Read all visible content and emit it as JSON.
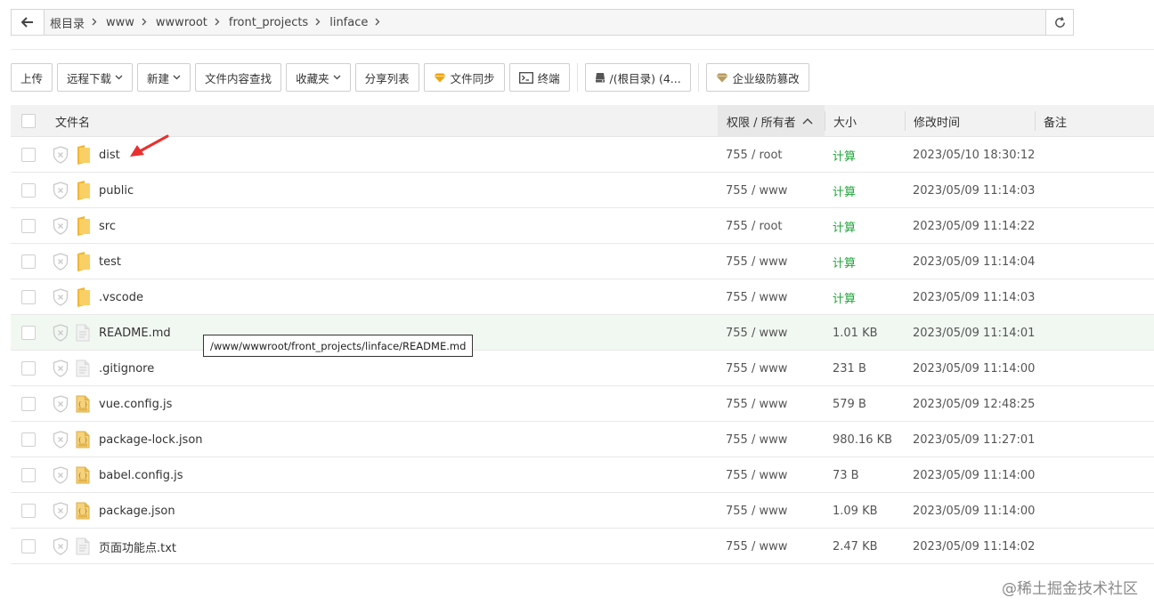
{
  "breadcrumb": [
    "根目录",
    "www",
    "wwwroot",
    "front_projects",
    "linface"
  ],
  "toolbar": {
    "upload": "上传",
    "remote_download": "远程下载",
    "new": "新建",
    "content_search": "文件内容查找",
    "favorites": "收藏夹",
    "share_list": "分享列表",
    "file_sync": "文件同步",
    "terminal": "终端",
    "disk": "/(根目录) (4...",
    "tamper": "企业级防篡改"
  },
  "columns": {
    "name": "文件名",
    "perm": "权限 / 所有者",
    "size": "大小",
    "mtime": "修改时间",
    "note": "备注"
  },
  "files": [
    {
      "name": "dist",
      "type": "folder",
      "perm": "755 / root",
      "size": "计算",
      "mtime": "2023/05/10 18:30:12"
    },
    {
      "name": "public",
      "type": "folder",
      "perm": "755 / www",
      "size": "计算",
      "mtime": "2023/05/09 11:14:03"
    },
    {
      "name": "src",
      "type": "folder",
      "perm": "755 / root",
      "size": "计算",
      "mtime": "2023/05/09 11:14:22"
    },
    {
      "name": "test",
      "type": "folder",
      "perm": "755 / www",
      "size": "计算",
      "mtime": "2023/05/09 11:14:04"
    },
    {
      "name": ".vscode",
      "type": "folder",
      "perm": "755 / www",
      "size": "计算",
      "mtime": "2023/05/09 11:14:03"
    },
    {
      "name": "README.md",
      "type": "text",
      "perm": "755 / www",
      "size": "1.01 KB",
      "mtime": "2023/05/09 11:14:01"
    },
    {
      "name": ".gitignore",
      "type": "text",
      "perm": "755 / www",
      "size": "231 B",
      "mtime": "2023/05/09 11:14:00"
    },
    {
      "name": "vue.config.js",
      "type": "code",
      "perm": "755 / www",
      "size": "579 B",
      "mtime": "2023/05/09 12:48:25"
    },
    {
      "name": "package-lock.json",
      "type": "code",
      "perm": "755 / www",
      "size": "980.16 KB",
      "mtime": "2023/05/09 11:27:01"
    },
    {
      "name": "babel.config.js",
      "type": "code",
      "perm": "755 / www",
      "size": "73 B",
      "mtime": "2023/05/09 11:14:00"
    },
    {
      "name": "package.json",
      "type": "code",
      "perm": "755 / www",
      "size": "1.09 KB",
      "mtime": "2023/05/09 11:14:00"
    },
    {
      "name": "页面功能点.txt",
      "type": "text",
      "perm": "755 / www",
      "size": "2.47 KB",
      "mtime": "2023/05/09 11:14:02"
    }
  ],
  "hover_row": 5,
  "tooltip": "/www/wwwroot/front_projects/linface/README.md",
  "watermark": "@稀土掘金技术社区",
  "colors": {
    "accent_green": "#20a53a",
    "folder": "#f7c94b",
    "arrow": "#e8302f",
    "gem": "#f0a30a"
  }
}
